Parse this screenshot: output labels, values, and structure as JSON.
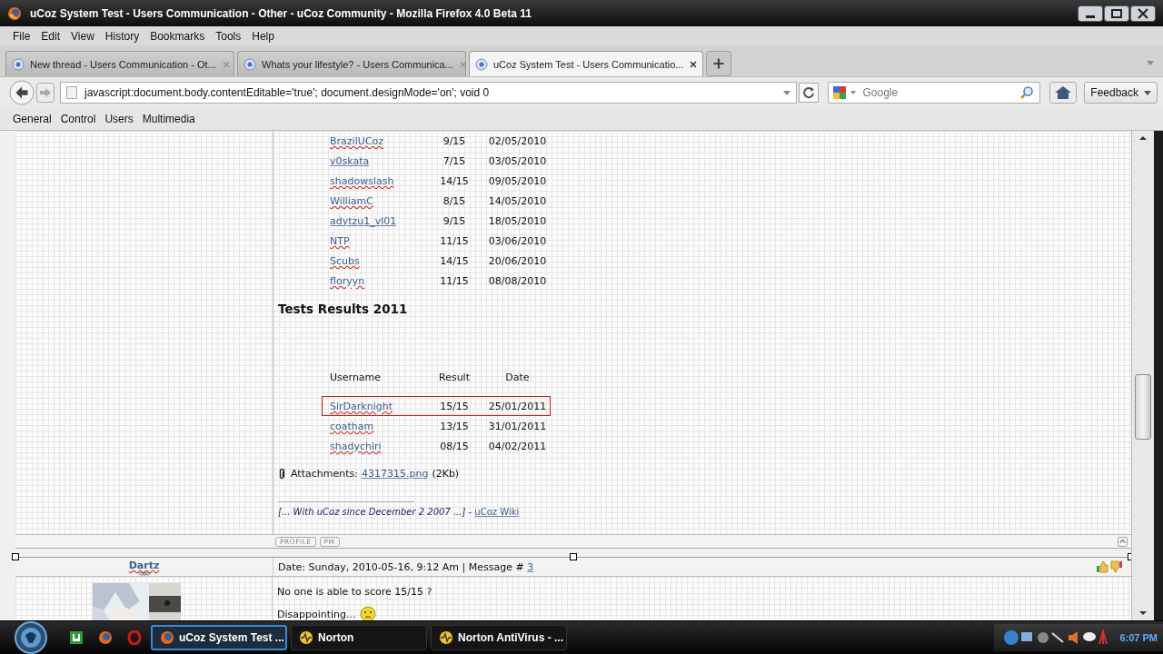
{
  "window": {
    "title": "uCoz System Test - Users Communication - Other - uCoz Community - Mozilla Firefox 4.0 Beta 11"
  },
  "menu": [
    "File",
    "Edit",
    "View",
    "History",
    "Bookmarks",
    "Tools",
    "Help"
  ],
  "tabs": [
    {
      "title": "New thread - Users Communication - Ot...",
      "selected": false
    },
    {
      "title": "Whats your lifestyle? - Users Communica...",
      "selected": false
    },
    {
      "title": "uCoz System Test - Users Communicatio...",
      "selected": true
    }
  ],
  "address": "javascript:document.body.contentEditable='true'; document.designMode='on'; void 0",
  "search": {
    "placeholder": "Google"
  },
  "feedback_button": "Feedback",
  "bookmarks": [
    "General",
    "Control",
    "Users",
    "Multimedia"
  ],
  "post_1": {
    "results_2010": [
      {
        "username": "BrazilUCoz",
        "result": "9/15",
        "date": "02/05/2010",
        "misspelled": true,
        "highlighted": false
      },
      {
        "username": "y0skata",
        "result": "7/15",
        "date": "03/05/2010",
        "misspelled": false,
        "highlighted": false
      },
      {
        "username": "shadowslash",
        "result": "14/15",
        "date": "09/05/2010",
        "misspelled": true,
        "highlighted": false
      },
      {
        "username": "WilliamC",
        "result": "8/15",
        "date": "14/05/2010",
        "misspelled": true,
        "highlighted": false
      },
      {
        "username": "adytzu1_vl01",
        "result": "9/15",
        "date": "18/05/2010",
        "misspelled": false,
        "highlighted": false
      },
      {
        "username": "NTP",
        "result": "11/15",
        "date": "03/06/2010",
        "misspelled": true,
        "highlighted": false
      },
      {
        "username": "Scubs",
        "result": "14/15",
        "date": "20/06/2010",
        "misspelled": true,
        "highlighted": false
      },
      {
        "username": "floryyn",
        "result": "11/15",
        "date": "08/08/2010",
        "misspelled": true,
        "highlighted": false
      }
    ],
    "heading": "Tests Results 2011",
    "columns": [
      "Username",
      "Result",
      "Date"
    ],
    "results_2011": [
      {
        "username": "SirDarknight",
        "result": "15/15",
        "date": "25/01/2011",
        "misspelled": true,
        "highlighted": true
      },
      {
        "username": "coatham",
        "result": "13/15",
        "date": "31/01/2011",
        "misspelled": true,
        "highlighted": false
      },
      {
        "username": "shadychiri",
        "result": "08/15",
        "date": "04/02/2011",
        "misspelled": true,
        "highlighted": false
      }
    ],
    "attachments_label": "Attachments:",
    "attachment_file": "4317315.png",
    "attachment_size": "(2Kb)",
    "signature": "[... With uCoz since December 2 2007 ...]",
    "signature_separator": " - ",
    "signature_link": "uCoz Wiki",
    "buttons": [
      "PROFILE",
      "PM"
    ]
  },
  "post_2": {
    "author": "Dartz",
    "date": "Date: Sunday, 2010-05-16, 9:12 Am | Message # ",
    "message_number": "3",
    "lines": [
      "No one is able to score 15/15 ?",
      "Disappointing..."
    ]
  },
  "taskbar": {
    "tasks": [
      {
        "label": "uCoz System Test ...",
        "selected": true
      },
      {
        "label": "Norton",
        "selected": false
      },
      {
        "label": "Norton AntiVirus - ...",
        "selected": false
      }
    ],
    "clock": "6:07 PM"
  }
}
